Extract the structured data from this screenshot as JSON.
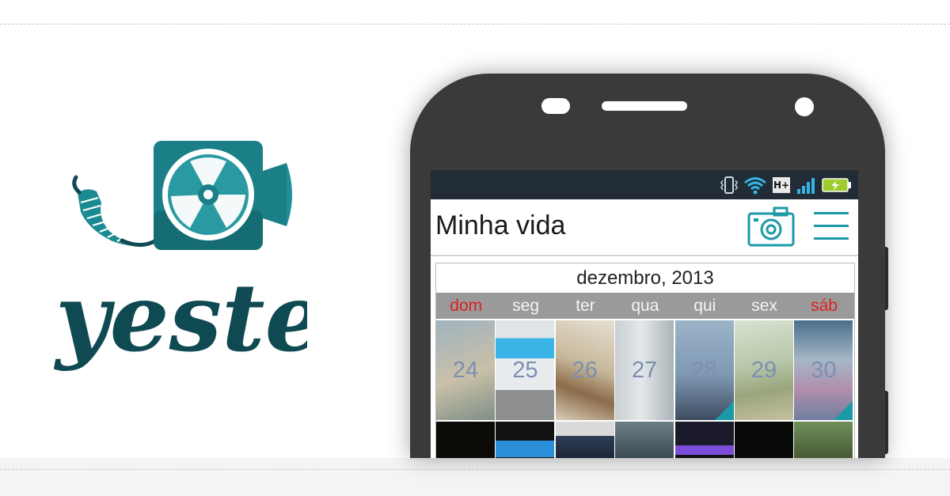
{
  "brand": {
    "wordmark": "yester",
    "primary_color": "#1b7f87",
    "dark_color": "#0f4a52"
  },
  "status_bar": {
    "icons": [
      "vibrate-icon",
      "wifi-icon",
      "hplus-network-icon",
      "signal-icon",
      "battery-charging-icon"
    ],
    "network_label": "H+"
  },
  "app": {
    "title": "Minha vida",
    "camera_button": "camera-icon",
    "menu_button": "menu-icon"
  },
  "calendar": {
    "month": "dezembro, 2013",
    "weekdays": [
      "dom",
      "seg",
      "ter",
      "qua",
      "qui",
      "sex",
      "sáb"
    ],
    "week1": [
      "24",
      "25",
      "26",
      "27",
      "28",
      "29",
      "30"
    ],
    "weekend_color": "#e02020"
  }
}
